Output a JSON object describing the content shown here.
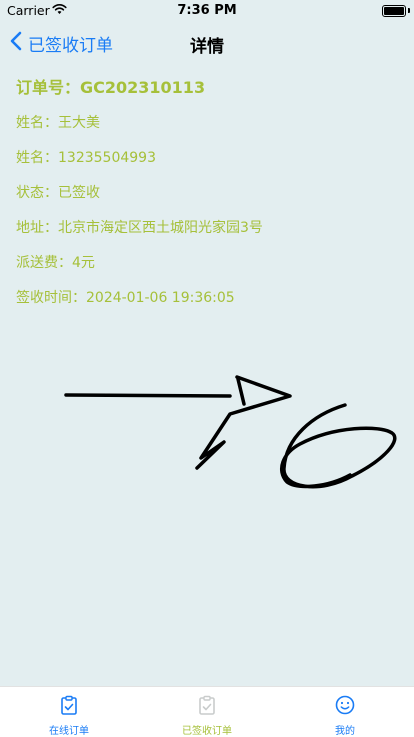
{
  "status": {
    "carrier": "Carrier",
    "time": "7:36 PM"
  },
  "nav": {
    "back_label": "已签收订单",
    "title": "详情"
  },
  "details": {
    "order": "订单号：GC202310113",
    "name": "姓名：王大美",
    "phone": "姓名：13235504993",
    "state": "状态：已签收",
    "address": "地址：北京市海定区西土城阳光家园3号",
    "fee": "派送费：4元",
    "signed_time": "签收时间：2024-01-06 19:36:05"
  },
  "tabs": [
    {
      "label": "在线订单"
    },
    {
      "label": "已签收订单"
    },
    {
      "label": "我的"
    }
  ],
  "colors": {
    "accent": "#1a7cf5",
    "highlight": "#a6c03a",
    "background": "#e3eef0"
  }
}
